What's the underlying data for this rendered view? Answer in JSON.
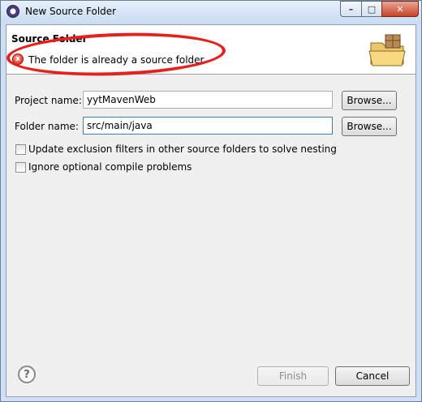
{
  "window": {
    "title": "New Source Folder",
    "controls": {
      "minimize": "–",
      "maximize": "□",
      "close": "✕"
    }
  },
  "header": {
    "title": "Source Folder",
    "message": "The folder is already a source folder.",
    "message_icon": "error-icon",
    "banner_icon": "new-folder-icon"
  },
  "form": {
    "project_label": "Project name:",
    "project_value": "yytMavenWeb",
    "project_browse": "Browse...",
    "folder_label": "Folder name:",
    "folder_value": "src/main/java",
    "folder_browse": "Browse...",
    "options": [
      {
        "label": "Update exclusion filters in other source folders to solve nesting",
        "checked": false
      },
      {
        "label": "Ignore optional compile problems",
        "checked": false
      }
    ]
  },
  "footer": {
    "help_icon": "help-icon",
    "finish_label": "Finish",
    "finish_enabled": false,
    "cancel_label": "Cancel"
  },
  "colors": {
    "error": "#d0210f",
    "annotation_ellipse": "#e8201c",
    "titlebar": "#c9dcf2"
  }
}
